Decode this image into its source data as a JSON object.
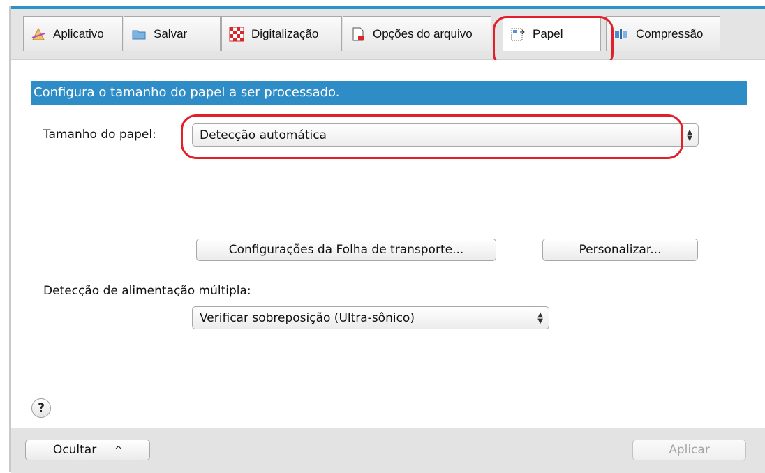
{
  "tabs": [
    {
      "label": "Aplicativo",
      "icon": "pen-tool-icon"
    },
    {
      "label": "Salvar",
      "icon": "folder-icon"
    },
    {
      "label": "Digitalização",
      "icon": "checkerboard-icon"
    },
    {
      "label": "Opções do arquivo",
      "icon": "document-icon"
    },
    {
      "label": "Papel",
      "icon": "paper-icon"
    },
    {
      "label": "Compressão",
      "icon": "compression-icon"
    }
  ],
  "active_tab": "Papel",
  "banner": "Configura o tamanho do papel a ser processado.",
  "paper_size": {
    "label": "Tamanho do papel:",
    "value": "Detecção automática"
  },
  "buttons": {
    "carrier_sheet": "Configurações da Folha de transporte...",
    "customize": "Personalizar...",
    "hide": "Ocultar",
    "apply": "Aplicar"
  },
  "multifeed": {
    "label": "Detecção de alimentação múltipla:",
    "value": "Verificar sobreposição (Ultra-sônico)"
  },
  "help": "?",
  "colors": {
    "accent_blue": "#2e8cc7",
    "highlight_red": "#e0202a"
  }
}
